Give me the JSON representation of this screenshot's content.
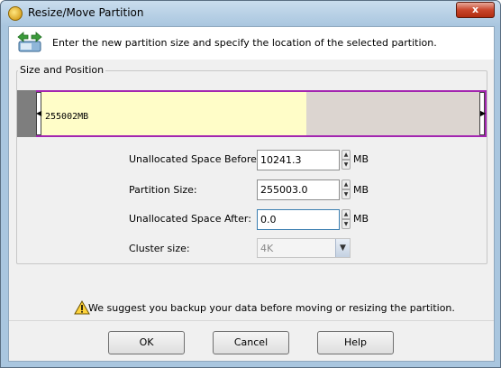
{
  "window": {
    "title": "Resize/Move Partition",
    "close_label": "x"
  },
  "header": {
    "instruction": "Enter the new partition size and specify the location of the selected partition."
  },
  "size_position": {
    "group_label": "Size and Position",
    "partition_label": "255002MB",
    "before_fraction": 0.04,
    "used_fraction": 0.6,
    "colors": {
      "unallocated": "#7e7e7e",
      "used": "#fffdc8",
      "free": "#dcd5d0",
      "border": "#a326b0"
    }
  },
  "fields": {
    "before": {
      "label": "Unallocated Space Before:",
      "value": "10241.3",
      "unit": "MB"
    },
    "size": {
      "label": "Partition Size:",
      "value": "255003.0",
      "unit": "MB"
    },
    "after": {
      "label": "Unallocated Space After:",
      "value": "0.0",
      "unit": "MB"
    },
    "cluster": {
      "label": "Cluster size:",
      "value": "4K"
    }
  },
  "warning": {
    "text": "We suggest you backup your data before moving or resizing the partition."
  },
  "buttons": {
    "ok": "OK",
    "cancel": "Cancel",
    "help": "Help"
  }
}
